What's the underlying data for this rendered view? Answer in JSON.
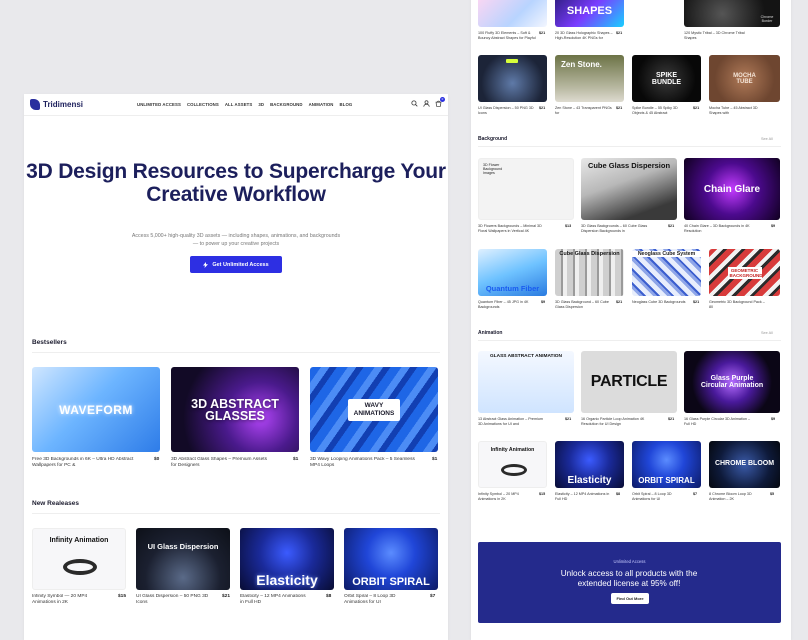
{
  "brand": {
    "name": "Tridimensi",
    "accent": "#2d2fe3"
  },
  "nav": [
    "UNLIMITED ACCESS",
    "COLLECTIONS",
    "ALL ASSETS",
    "3D",
    "BACKGROUND",
    "ANIMATION",
    "BLOG"
  ],
  "header_icons": [
    "search-icon",
    "user-icon",
    "cart-icon"
  ],
  "cart_count": "0",
  "hero": {
    "title": "3D Design Resources to Supercharge Your Creative Workflow",
    "subtitle": "Access 5,000+ high-quality 3D assets — including shapes, animations, and backgrounds — to power up your creative projects",
    "cta": "Get Unlimited Access"
  },
  "bestsellers": {
    "title": "Bestsellers",
    "items": [
      {
        "title": "Free 3D Backgrounds in 6K – Ultra HD Abstract Wallpapers for PC &",
        "price": "$0",
        "art": "WAVEFORM"
      },
      {
        "title": "3D Abstract Glass Shapes – Premium Assets for Designers",
        "price": "$1",
        "art": "3D ABSTRACT GLASSES"
      },
      {
        "title": "3D Wavy Looping Animations Pack – 5 Seamless MP4 Loops",
        "price": "$1",
        "art": "WAVY ANIMATIONS"
      }
    ]
  },
  "new_releases": {
    "title": "New Realeases",
    "items": [
      {
        "title": "Infinity Symbol — 20 MP4 Animations in 2K",
        "price": "$15",
        "art": "Infinity Animation"
      },
      {
        "title": "UI Glass Dispersion – 50 PNG 3D Icons",
        "price": "$21",
        "art": "UI Glass Dispersion"
      },
      {
        "title": "Elasticity – 12 MP4 Animations in Full HD",
        "price": "$8",
        "art": "Elasticity"
      },
      {
        "title": "Orbit Spiral – 8 Loop 3D Animations for UI",
        "price": "$7",
        "art": "ORBIT SPIRAL"
      }
    ]
  },
  "right_top": {
    "items": [
      {
        "title": "100 Fluffy 3D Elements – Soft & Bouncy Abstract Shapes for Playful",
        "price": "$21",
        "art": ""
      },
      {
        "title": "20 3D Glass Holographic Shapes – High-Resolution 4K PNGs for",
        "price": "$21",
        "art": "SHAPES"
      },
      {
        "title": "120 Mystic Tribal – 3D Chrome Tribal Shapes",
        "price": "$21",
        "art": "Chrome Border"
      },
      {
        "title": "UI Glass Dispersion – 50 PNG 3D Icons",
        "price": "$21",
        "art": ""
      },
      {
        "title": "Zen Stone – 43 Transparent PNGs for",
        "price": "$21",
        "art": "Zen Stone."
      },
      {
        "title": "Spike Bundle – 55 Spiky 3D Objects & 45 Abstract",
        "price": "$21",
        "art": "SPIKE BUNDLE"
      },
      {
        "title": "Mocha Tube – 45 Abstract 3D Shapes with",
        "price": "$21",
        "art": "MOCHA TUBE"
      }
    ]
  },
  "background": {
    "title": "Background",
    "see_all": "See All",
    "items": [
      {
        "title": "3D Flowers Backgrounds – Minimal 3D Floral Wallpapers in Vertical 4K",
        "price": "$13",
        "art": "3D Flower Background Images"
      },
      {
        "title": "3D Glass Backgrounds – 60 Cube Glass Dispersion Backgrounds in",
        "price": "$21",
        "art": "Cube Glass Dispersion"
      },
      {
        "title": "40 Chain Glare – 3D Backgrounds in 4K Resolution",
        "price": "$9",
        "art": "Chain Glare"
      },
      {
        "title": "Quantum Fiber – 45 JPG in 4K Backgrounds",
        "price": "$9",
        "art": "Quantum Fiber"
      },
      {
        "title": "3D Glass Background – 60 Cube Glass Dispersion",
        "price": "$21",
        "art": "Cube Glass Dispersion"
      },
      {
        "title": "Neoglass Cube 3D Backgrounds",
        "price": "$21",
        "art": "Neoglass Cube System"
      },
      {
        "title": "Geometric 3D Background Pack – 80",
        "price": "$21",
        "art": "GEOMETRIC BACKGROUND"
      }
    ]
  },
  "animation": {
    "title": "Animation",
    "see_all": "See All",
    "items": [
      {
        "title": "13 Abstract Glass Animation – Premium 3D Animations for UI and",
        "price": "$21",
        "art": "GLASS ABSTRACT ANIMATION"
      },
      {
        "title": "16 Organic Particle Loop Animation 4K Resolution for UI Design",
        "price": "$21",
        "art": "PARTICLE"
      },
      {
        "title": "16 Glass Purple Circular 3D Animation – Full HD",
        "price": "$9",
        "art": "Glass Purple Circular Animation"
      },
      {
        "title": "Infinity Symbol – 20 MP4 Animations in 2K",
        "price": "$15",
        "art": "Infinity Animation"
      },
      {
        "title": "Elasticity – 12 MP4 Animations in Full HD",
        "price": "$8",
        "art": "Elasticity"
      },
      {
        "title": "Orbit Spiral – 8 Loop 3D Animations for UI",
        "price": "$7",
        "art": "ORBIT SPIRAL"
      },
      {
        "title": "8 Chrome Bloom Loop 3D Animation – 2K",
        "price": "$5",
        "art": "CHROME BLOOM"
      }
    ]
  },
  "promo": {
    "small": "Unlimited Access",
    "headline": "Unlock access to all products with the extended license at 95% off!",
    "button": "Find Out More"
  }
}
